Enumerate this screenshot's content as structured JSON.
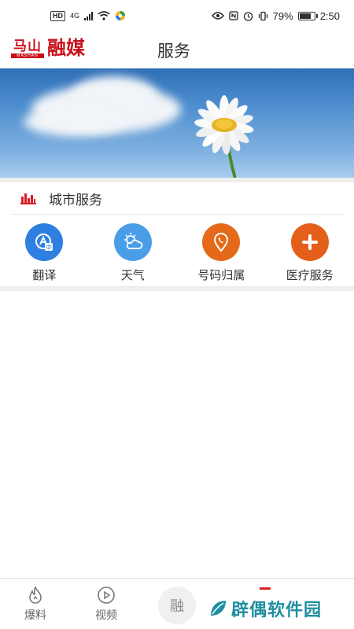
{
  "status_bar": {
    "hd": "HD",
    "network": "4G",
    "battery_percent": "79%",
    "time": "2:50",
    "battery_level": 0.79
  },
  "header": {
    "logo_top": "马山",
    "logo_sub": "MASHAN",
    "logo_main": "融媒",
    "title": "服务"
  },
  "city_services": {
    "title": "城市服务",
    "items": [
      {
        "label": "翻译",
        "icon": "translate-icon",
        "color": "#2f7fe0"
      },
      {
        "label": "天气",
        "icon": "weather-icon",
        "color": "#4a9ee8"
      },
      {
        "label": "号码归属",
        "icon": "phone-location-icon",
        "color": "#e46a1a"
      },
      {
        "label": "医疗服务",
        "icon": "medical-plus-icon",
        "color": "#e4601a"
      }
    ]
  },
  "bottom_nav": {
    "items": [
      {
        "label": "爆料",
        "icon": "fire-icon"
      },
      {
        "label": "视频",
        "icon": "play-icon"
      },
      {
        "label": "融",
        "icon": "rong-center-icon"
      }
    ]
  },
  "watermark": {
    "text": "辟偶软件园"
  },
  "colors": {
    "brand_red": "#c8101a",
    "sky_blue": "#4f8fd0",
    "watermark_teal": "#1f8fa0"
  }
}
